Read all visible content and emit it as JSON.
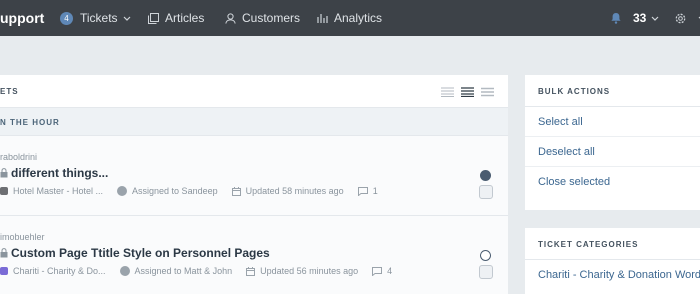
{
  "header": {
    "brand": "upport",
    "nav": {
      "tickets": {
        "label": "Tickets",
        "count": "4"
      },
      "articles": {
        "label": "Articles"
      },
      "customers": {
        "label": "Customers"
      },
      "analytics": {
        "label": "Analytics"
      }
    },
    "notifications": {
      "count": "33"
    }
  },
  "tickets_panel": {
    "title": "ETS",
    "group_title": "N THE HOUR",
    "tickets": [
      {
        "user": "raboldrini",
        "title": "different things...",
        "app": "Hotel Master - Hotel ...",
        "app_color": "#6d6f73",
        "assigned": "Assigned to Sandeep",
        "updated": "Updated 58 minutes ago",
        "comments": "1",
        "status": "filled",
        "status_color": "#4a5c70"
      },
      {
        "user": "imobuehler",
        "title": "Custom Page Ttitle Style on Personnel Pages",
        "app": "Chariti - Charity & Do...",
        "app_color": "#7a6bd6",
        "assigned": "Assigned to Matt & John",
        "updated": "Updated 56 minutes ago",
        "comments": "4",
        "status": "open",
        "status_color": "#4a5c70"
      }
    ]
  },
  "bulk_actions": {
    "title": "BULK ACTIONS",
    "items": [
      "Select all",
      "Deselect all",
      "Close selected"
    ]
  },
  "ticket_categories": {
    "title": "TICKET CATEGORIES",
    "items": [
      "Chariti - Charity & Donation WordPr"
    ]
  }
}
